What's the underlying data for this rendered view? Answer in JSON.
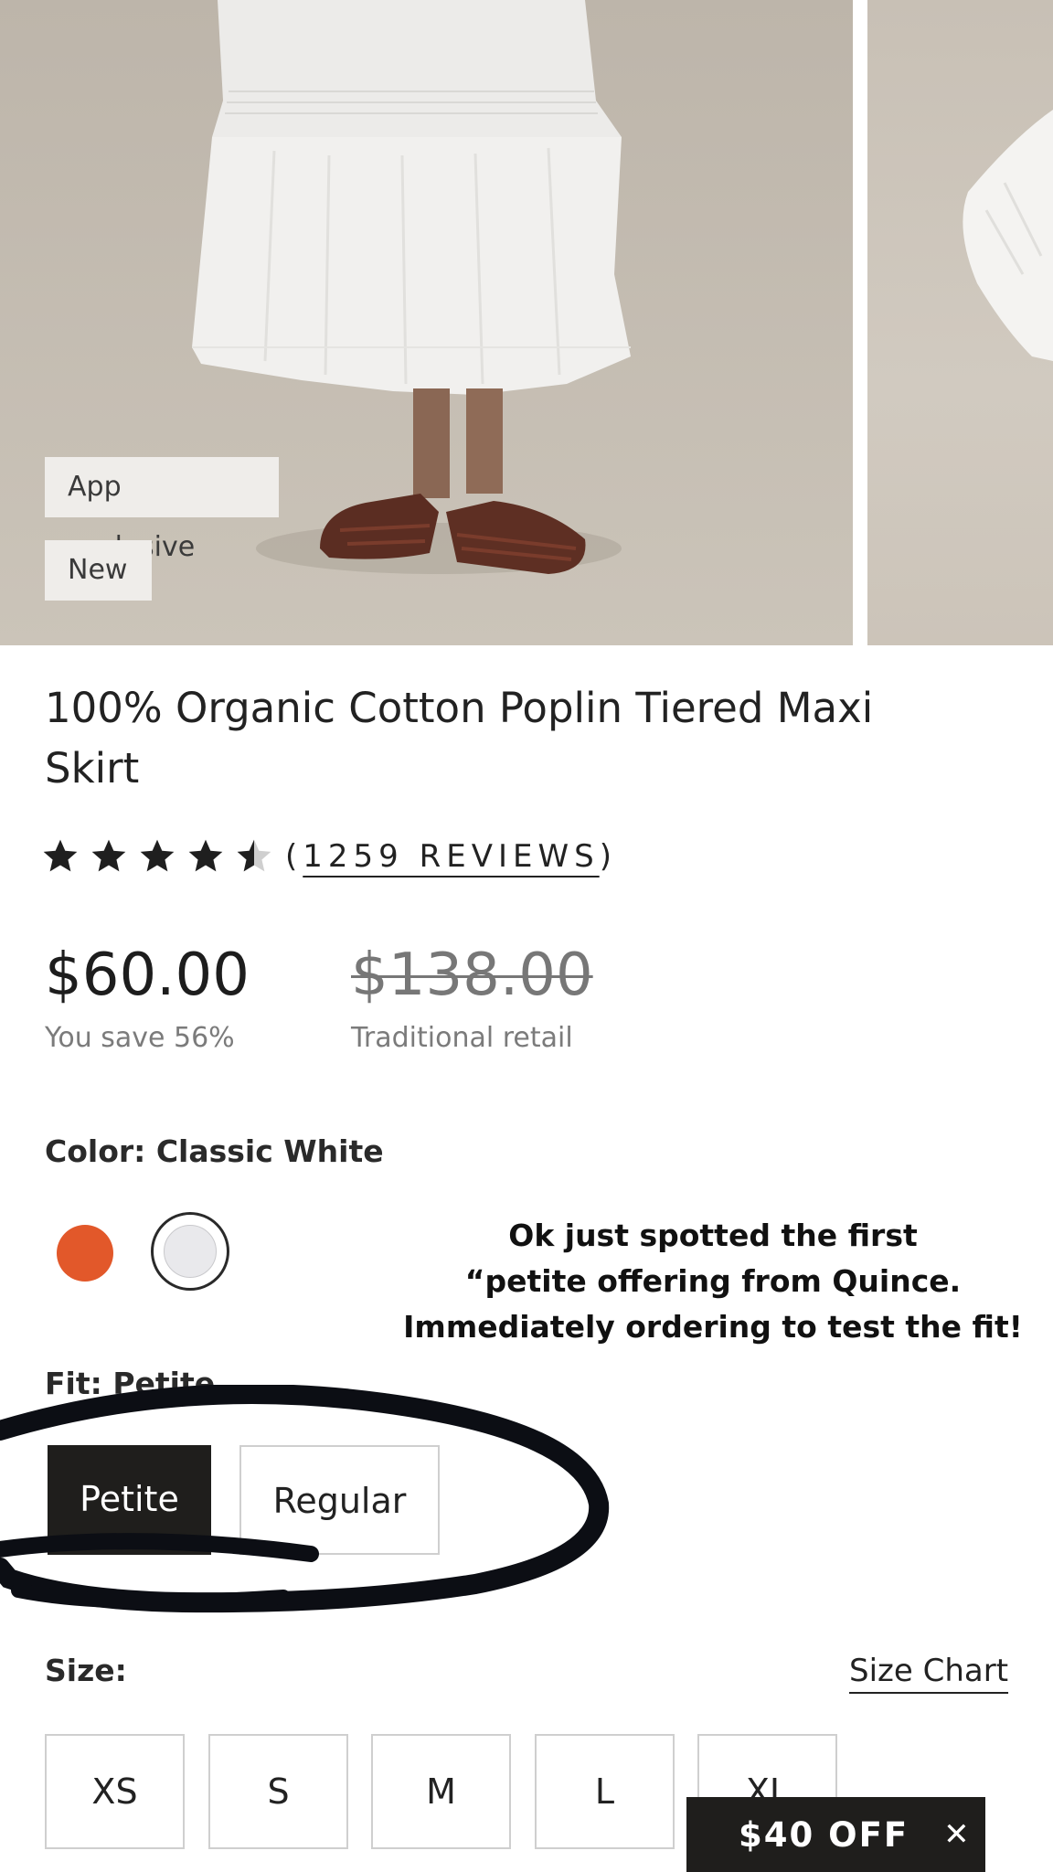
{
  "gallery": {
    "badges": [
      "App exclusive",
      "New"
    ]
  },
  "product": {
    "title": "100% Organic Cotton Poplin Tiered Maxi Skirt",
    "rating": 4.5,
    "rating_max": 5,
    "reviews_open": "(",
    "reviews_label": "1259 REVIEWS",
    "reviews_close": ")",
    "price": "$60.00",
    "savings": "You save 56%",
    "original_price": "$138.00",
    "original_price_note": "Traditional retail"
  },
  "color": {
    "label": "Color: Classic White",
    "swatches": [
      {
        "name": "orange",
        "hex": "#e2582a",
        "selected": false
      },
      {
        "name": "Classic White",
        "hex": "#e9e9ec",
        "selected": true
      }
    ]
  },
  "annotation": {
    "line1": "Ok just spotted the first",
    "line2": "“petite offering from Quince.",
    "line3": "Immediately ordering to test the fit!"
  },
  "fit": {
    "label": "Fit: Petite",
    "options": [
      "Petite",
      "Regular"
    ],
    "selected": "Petite"
  },
  "size": {
    "label": "Size:",
    "chart_link": "Size Chart",
    "options": [
      "XS",
      "S",
      "M",
      "L",
      "XL"
    ]
  },
  "promo": {
    "text": "$40 OFF",
    "close_icon": "close-icon"
  }
}
